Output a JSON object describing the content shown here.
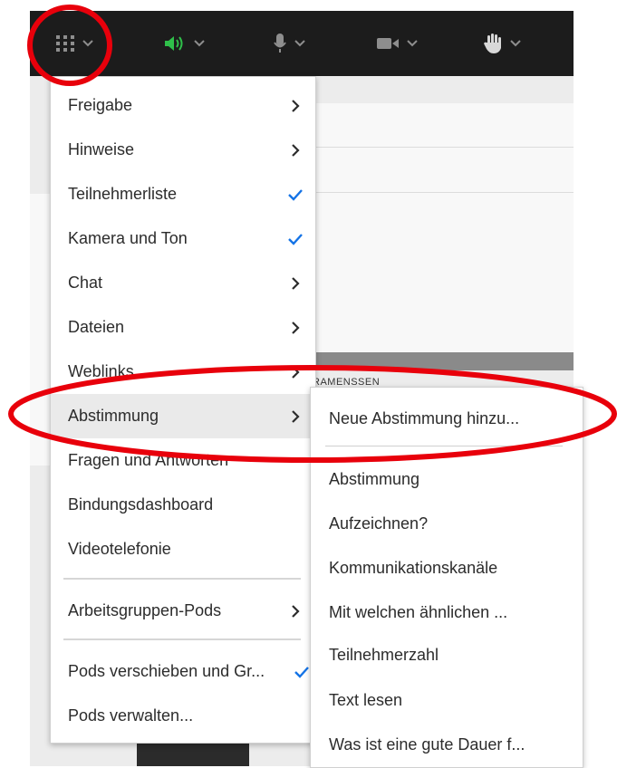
{
  "colors": {
    "toolbar_bg": "#1c1c1c",
    "speaker_active": "#2fbf4a",
    "icon_grey": "#8e8e8e",
    "check_blue": "#1473e6",
    "annotation_red": "#e8000b"
  },
  "toolbar": {
    "icons": [
      "grid-menu-icon",
      "speaker-icon",
      "microphone-icon",
      "camera-icon",
      "raise-hand-icon"
    ]
  },
  "background": {
    "text": "RAMENSSEN"
  },
  "menu": {
    "items": [
      {
        "label": "Freigabe",
        "indicator": "chevron"
      },
      {
        "label": "Hinweise",
        "indicator": "chevron"
      },
      {
        "label": "Teilnehmerliste",
        "indicator": "check"
      },
      {
        "label": "Kamera und Ton",
        "indicator": "check"
      },
      {
        "label": "Chat",
        "indicator": "chevron"
      },
      {
        "label": "Dateien",
        "indicator": "chevron"
      },
      {
        "label": "Weblinks",
        "indicator": "chevron"
      },
      {
        "label": "Abstimmung",
        "indicator": "chevron"
      },
      {
        "label": "Fragen und Antworten",
        "indicator": "none"
      },
      {
        "label": "Bindungsdashboard",
        "indicator": "none"
      },
      {
        "label": "Videotelefonie",
        "indicator": "none"
      },
      {
        "label": "Arbeitsgruppen-Pods",
        "indicator": "chevron"
      },
      {
        "label": "Pods verschieben und Gr...",
        "indicator": "check"
      },
      {
        "label": "Pods verwalten...",
        "indicator": "none"
      }
    ]
  },
  "submenu": {
    "items": [
      {
        "label": "Neue Abstimmung hinzu..."
      },
      {
        "label": "Abstimmung"
      },
      {
        "label": "Aufzeichnen?"
      },
      {
        "label": "Kommunikationskanäle"
      },
      {
        "label": "Mit welchen ähnlichen ..."
      },
      {
        "label": "Teilnehmerzahl"
      },
      {
        "label": "Text lesen"
      },
      {
        "label": "Was ist eine gute Dauer f..."
      }
    ]
  }
}
